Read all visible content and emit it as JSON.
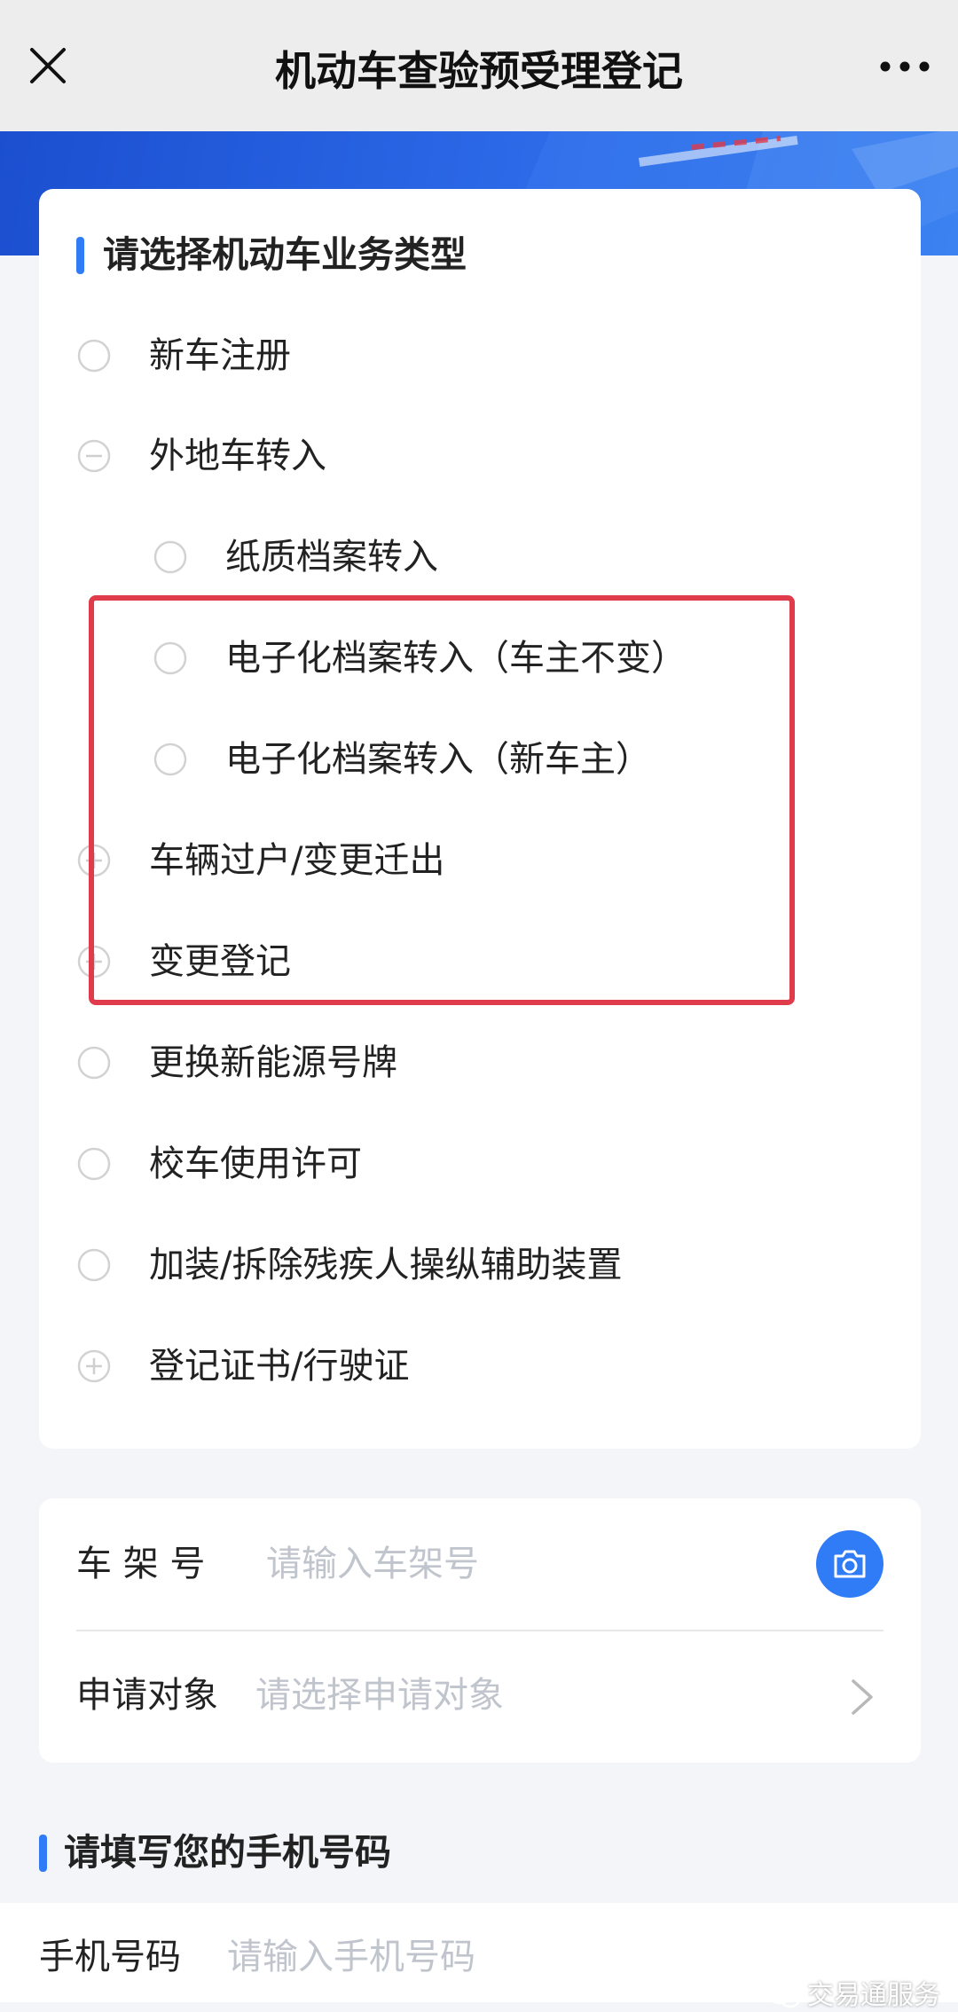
{
  "nav": {
    "title": "机动车查验预受理登记"
  },
  "vehicle_section": {
    "title": "请选择机动车业务类型",
    "options": [
      {
        "label": "新车注册",
        "icon": "radio-icon"
      },
      {
        "label": "外地车转入",
        "icon": "collapse-icon",
        "expanded": true,
        "children": [
          {
            "label": "纸质档案转入",
            "icon": "radio-icon"
          },
          {
            "label": "电子化档案转入（车主不变）",
            "icon": "radio-icon"
          },
          {
            "label": "电子化档案转入（新车主）",
            "icon": "radio-icon"
          }
        ]
      },
      {
        "label": "车辆过户/变更迁出",
        "icon": "expand-icon"
      },
      {
        "label": "变更登记",
        "icon": "expand-icon"
      },
      {
        "label": "更换新能源号牌",
        "icon": "radio-icon"
      },
      {
        "label": "校车使用许可",
        "icon": "radio-icon"
      },
      {
        "label": "加装/拆除残疾人操纵辅助装置",
        "icon": "radio-icon"
      },
      {
        "label": "登记证书/行驶证",
        "icon": "expand-icon"
      }
    ],
    "highlight_color": "#e03b4b"
  },
  "form": {
    "vin_label": "车 架 号",
    "vin_placeholder": "请输入车架号",
    "vin_value": "",
    "applicant_label": "申请对象",
    "applicant_placeholder": "请选择申请对象"
  },
  "phone_section": {
    "title": "请填写您的手机号码",
    "label": "手机号码",
    "placeholder": "请输入手机号码",
    "value": ""
  },
  "watermark": {
    "text": "交易通服务"
  },
  "colors": {
    "accent": "#2f7cf6",
    "banner": "#1b4fd0",
    "highlight": "#e03b4b"
  }
}
